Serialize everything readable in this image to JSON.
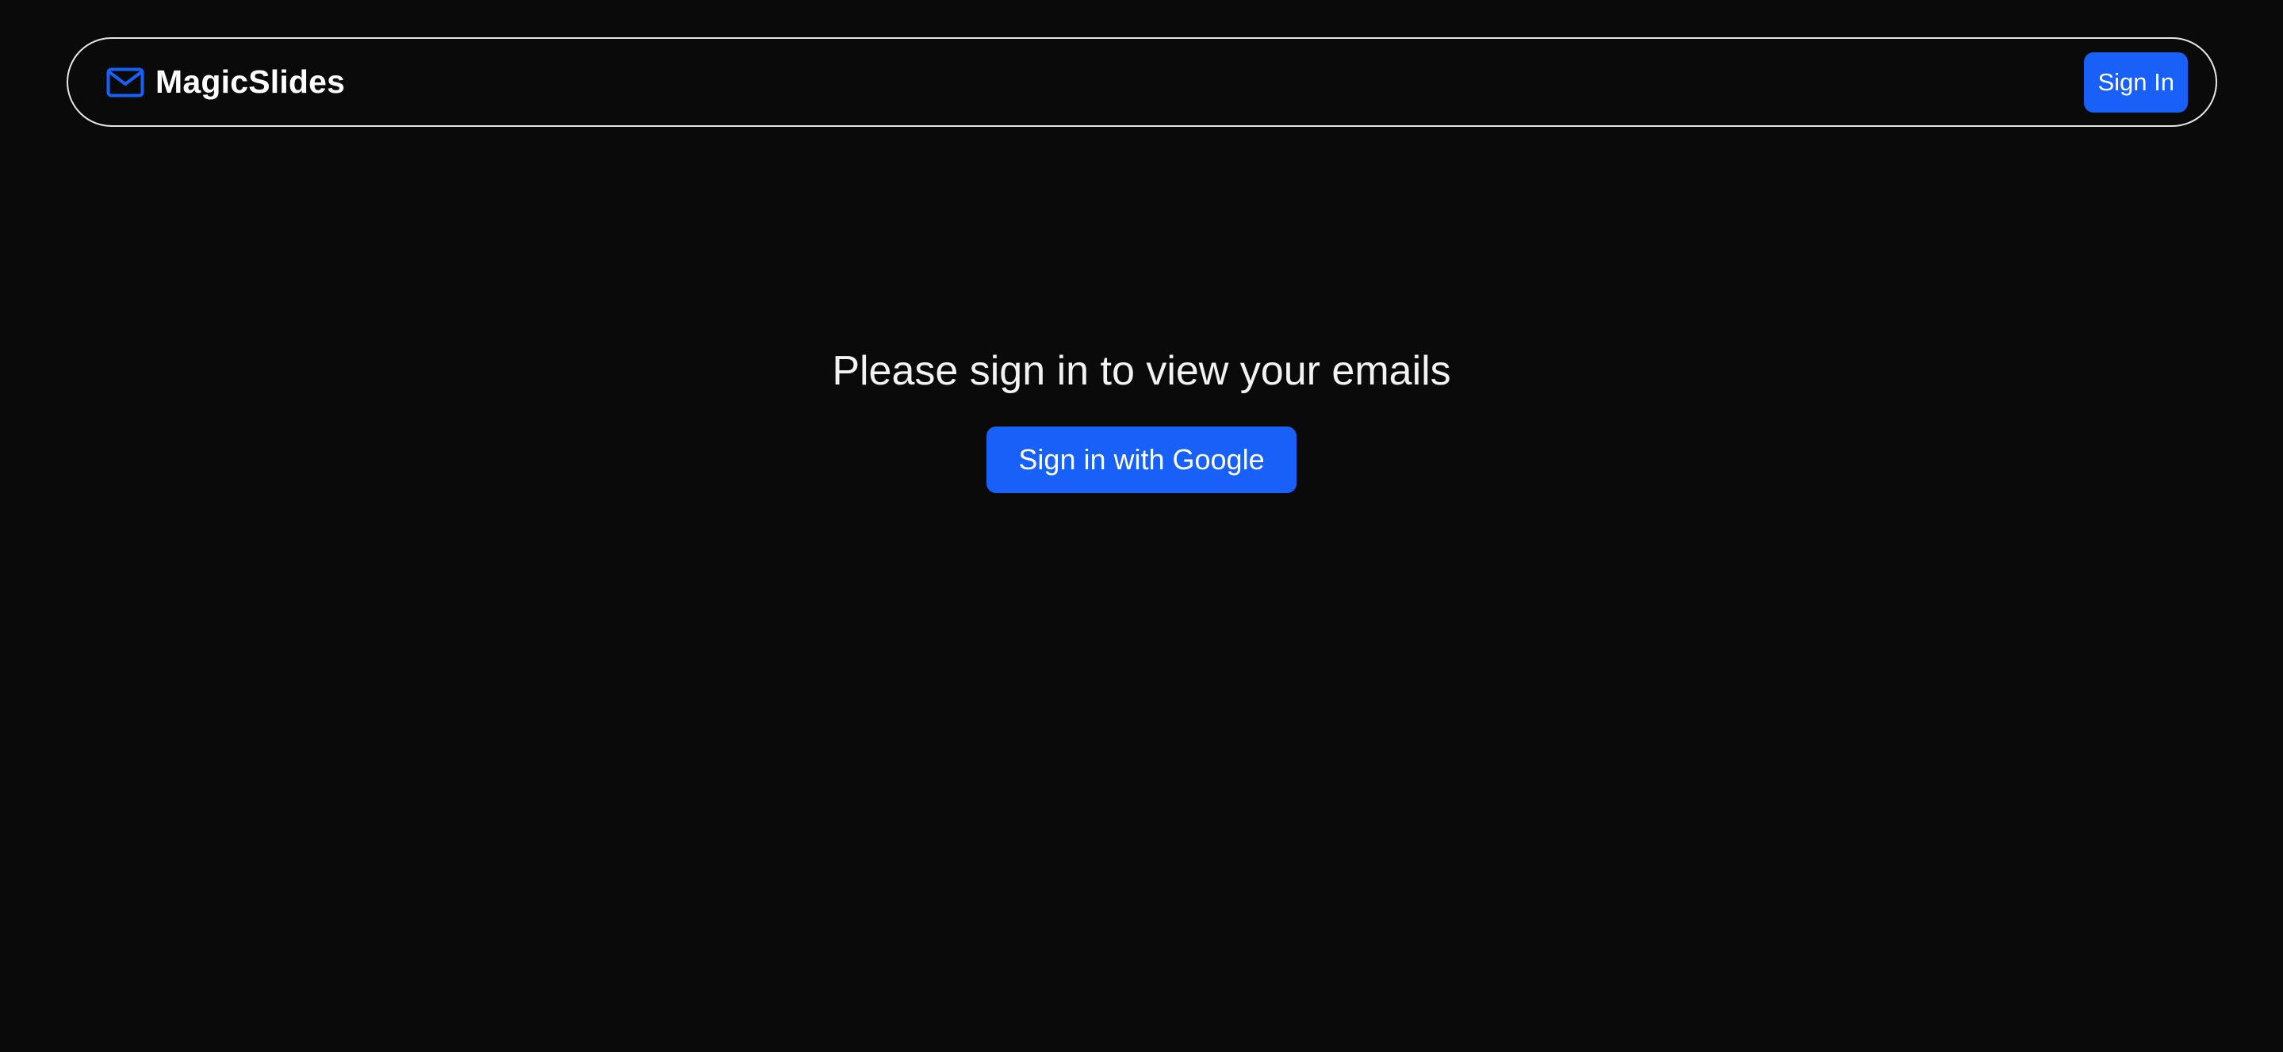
{
  "colors": {
    "background": "#0a0a0a",
    "accent": "#1860f7",
    "nav_border": "#e6e6e6",
    "text": "#ffffff"
  },
  "header": {
    "logo_icon": "mail-icon",
    "brand_name": "MagicSlides",
    "sign_in_label": "Sign In"
  },
  "main": {
    "message": "Please sign in to view your emails",
    "google_sign_in_label": "Sign in with Google"
  }
}
